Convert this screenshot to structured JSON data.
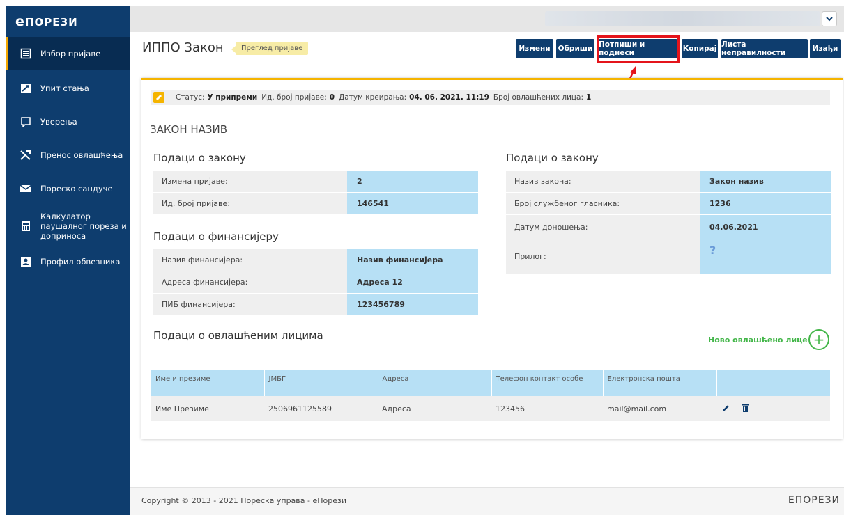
{
  "brand": {
    "e": "е",
    "name": "Порези"
  },
  "sidebar": {
    "items": [
      {
        "label": "Избор пријаве",
        "icon": "list-form-icon"
      },
      {
        "label": "Упит стања",
        "icon": "chart-icon"
      },
      {
        "label": "Уверења",
        "icon": "certificate-icon"
      },
      {
        "label": "Пренос овлашћења",
        "icon": "transfer-icon"
      },
      {
        "label": "Пореско сандуче",
        "icon": "mail-icon"
      },
      {
        "label": "Калкулатор паушалног пореза и доприноса",
        "icon": "calculator-icon"
      },
      {
        "label": "Профил обвезника",
        "icon": "profile-icon"
      }
    ]
  },
  "header": {
    "title": "ИППО Закон",
    "badge": "Преглед пријаве",
    "buttons": {
      "edit": "Измени",
      "delete": "Обриши",
      "sign_submit": "Потпиши и поднеси",
      "copy": "Копирај",
      "errors": "Листа неправилности",
      "exit": "Изађи"
    }
  },
  "status": {
    "status_label": "Статус:",
    "status_value": "У припреми",
    "id_label": "Ид. број пријаве:",
    "id_value": "0",
    "created_label": "Датум креирања:",
    "created_value": "04. 06. 2021. 11:19",
    "count_label": "Број овлашћених лица:",
    "count_value": "1"
  },
  "law_name": "ЗАКОН НАЗИВ",
  "law_data_left": {
    "title": "Подаци о закону",
    "rows": [
      {
        "k": "Измена пријаве:",
        "v": "2"
      },
      {
        "k": "Ид. број пријаве:",
        "v": "146541"
      }
    ]
  },
  "financier": {
    "title": "Подаци о финансијеру",
    "rows": [
      {
        "k": "Назив финансијера:",
        "v": "Назив финансијера"
      },
      {
        "k": "Адреса финансијера:",
        "v": "Адреса 12"
      },
      {
        "k": "ПИБ финансијера:",
        "v": "123456789"
      }
    ]
  },
  "law_data_right": {
    "title": "Подаци о закону",
    "rows": [
      {
        "k": "Назив закона:",
        "v": "Закон назив"
      },
      {
        "k": "Број службеног гласника:",
        "v": "1236"
      },
      {
        "k": "Датум доношења:",
        "v": "04.06.2021"
      },
      {
        "k": "Прилог:",
        "v": "?"
      }
    ]
  },
  "persons": {
    "title": "Подаци о овлашћеним лицима",
    "add_label": "Ново овлашћено лице",
    "columns": [
      "Име и презиме",
      "ЈМБГ",
      "Адреса",
      "Телефон контакт особе",
      "Електронска пошта",
      ""
    ],
    "rows": [
      [
        "Име Презиме",
        "2506961125589",
        "Адреса",
        "123456",
        "mail@mail.com"
      ]
    ]
  },
  "footer": {
    "copyright": "Copyright © 2013 - 2021 Пореска управа - еПорези",
    "logo": "еПорези"
  },
  "colors": {
    "navy": "#0e3d6e",
    "accent": "#f5b400",
    "light_blue": "#b7e0f5",
    "green": "#43b649",
    "red": "#e4141b"
  }
}
